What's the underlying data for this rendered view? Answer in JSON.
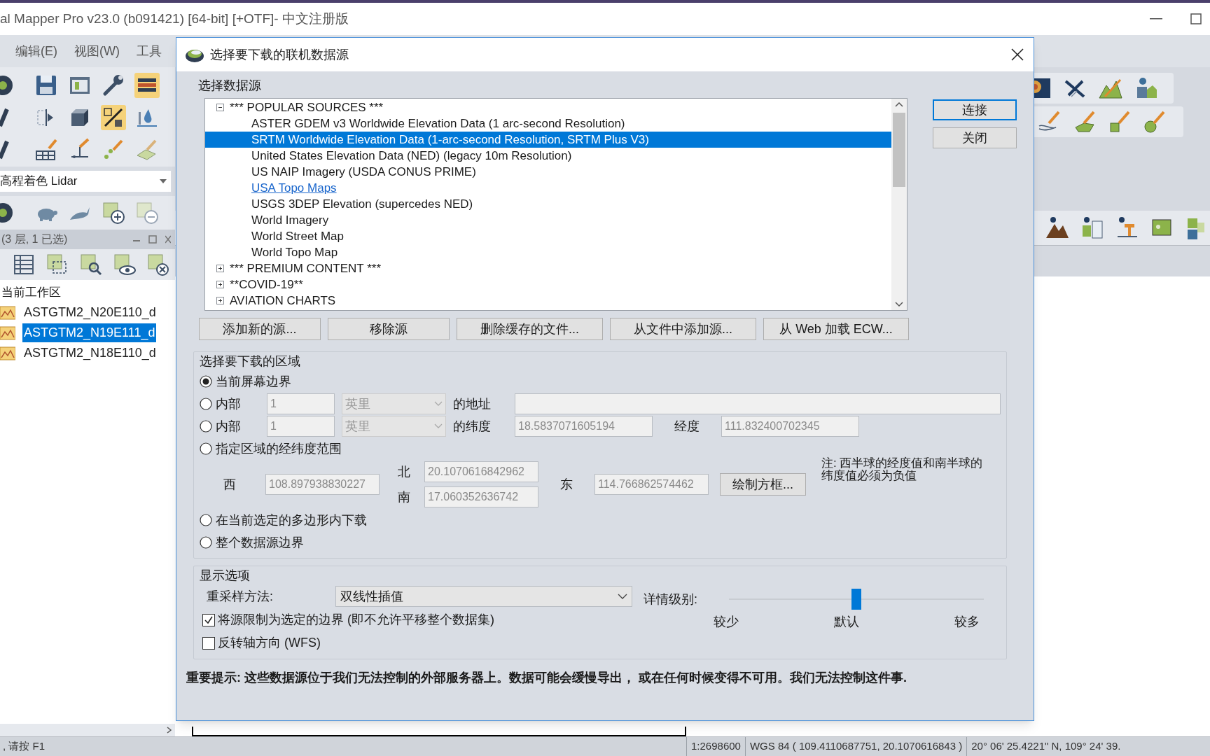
{
  "app": {
    "title": "al Mapper Pro v23.0 (b091421) [64-bit] [+OTF]- 中文注册版",
    "menu": [
      "编辑(E)",
      "视图(W)",
      "工具"
    ]
  },
  "left_panel": {
    "style_dropdown": "高程着色 Lidar",
    "layers_header": "(3 层, 1 已选)",
    "workspace": {
      "label": "当前工作区",
      "children": [
        {
          "label": "ASTGTM2_N20E110_d",
          "selected": false
        },
        {
          "label": "ASTGTM2_N19E111_d",
          "selected": true
        },
        {
          "label": "ASTGTM2_N18E110_d",
          "selected": false
        }
      ]
    }
  },
  "dialog": {
    "title": "选择要下载的联机数据源",
    "source_group": "选择数据源",
    "sources": [
      {
        "label": "*** POPULAR SOURCES ***",
        "expanded": true,
        "children": [
          {
            "label": "ASTER GDEM v3 Worldwide Elevation Data (1 arc-second Resolution)",
            "selected": false,
            "kind": "item"
          },
          {
            "label": "SRTM Worldwide Elevation Data (1-arc-second Resolution, SRTM Plus V3)",
            "selected": true,
            "kind": "item"
          },
          {
            "label": "United States Elevation Data (NED) (legacy 10m Resolution)",
            "selected": false,
            "kind": "item"
          },
          {
            "label": "US NAIP Imagery (USDA CONUS PRIME)",
            "selected": false,
            "kind": "item"
          },
          {
            "label": "USA Topo Maps",
            "selected": false,
            "kind": "link"
          },
          {
            "label": "USGS 3DEP Elevation (supercedes NED)",
            "selected": false,
            "kind": "item"
          },
          {
            "label": "World Imagery",
            "selected": false,
            "kind": "item"
          },
          {
            "label": "World Street Map",
            "selected": false,
            "kind": "item"
          },
          {
            "label": "World Topo Map",
            "selected": false,
            "kind": "item"
          }
        ]
      },
      {
        "label": "*** PREMIUM CONTENT ***",
        "expanded": false
      },
      {
        "label": "**COVID-19**",
        "expanded": false
      },
      {
        "label": "AVIATION CHARTS",
        "expanded": false
      }
    ],
    "side_buttons": [
      {
        "label": "连接",
        "default": true
      },
      {
        "label": "关闭",
        "default": false
      }
    ],
    "source_buttons": [
      "添加新的源...",
      "移除源",
      "删除缓存的文件...",
      "从文件中添加源...",
      "从 Web 加载 ECW..."
    ],
    "area": {
      "title": "选择要下载的区域",
      "options": [
        {
          "kind": "plain",
          "label": "当前屏幕边界",
          "selected": true
        },
        {
          "kind": "address",
          "label": "内部",
          "selected": false,
          "distance": "1",
          "unit": "英里",
          "of_label": "的地址"
        },
        {
          "kind": "point",
          "label": "内部",
          "selected": false,
          "distance": "1",
          "unit": "英里",
          "lat_label": "的纬度",
          "lat": "18.5837071605194",
          "lon_label": "经度",
          "lon": "111.832400702345"
        },
        {
          "kind": "bounds",
          "label": "指定区域的经纬度范围",
          "selected": false,
          "west_label": "西",
          "west": "108.897938830227",
          "north_label": "北",
          "north": "20.1070616842962",
          "south_label": "南",
          "south": "17.060352636742",
          "east_label": "东",
          "east": "114.766862574462",
          "draw_button": "绘制方框...",
          "note": "注: 西半球的经度值和南半球的纬度值必须为负值"
        },
        {
          "kind": "plain",
          "label": "在当前选定的多边形内下载",
          "selected": false
        },
        {
          "kind": "plain",
          "label": "整个数据源边界",
          "selected": false
        }
      ]
    },
    "display": {
      "title": "显示选项",
      "resample_label": "重采样方法:",
      "resample": "双线性插值",
      "detail_label": "详情级别:",
      "detail": {
        "level": 0.5,
        "ticks": [
          "较少",
          "默认",
          "较多"
        ]
      },
      "checks": [
        {
          "label": "将源限制为选定的边界 (即不允许平移整个数据集)",
          "checked": true
        },
        {
          "label": "反转轴方向 (WFS)",
          "checked": false
        }
      ]
    },
    "notice": "重要提示:  这些数据源位于我们无法控制的外部服务器上。数据可能会缓慢导出， 或在任何时候变得不可用。我们无法控制这件事."
  },
  "status_bar": {
    "help": ", 请按 F1",
    "scale": "1:2698600",
    "coords": "WGS 84 ( 109.4110687751, 20.1070616843 )",
    "dms": "20° 06' 25.4221\" N, 109° 24' 39."
  }
}
